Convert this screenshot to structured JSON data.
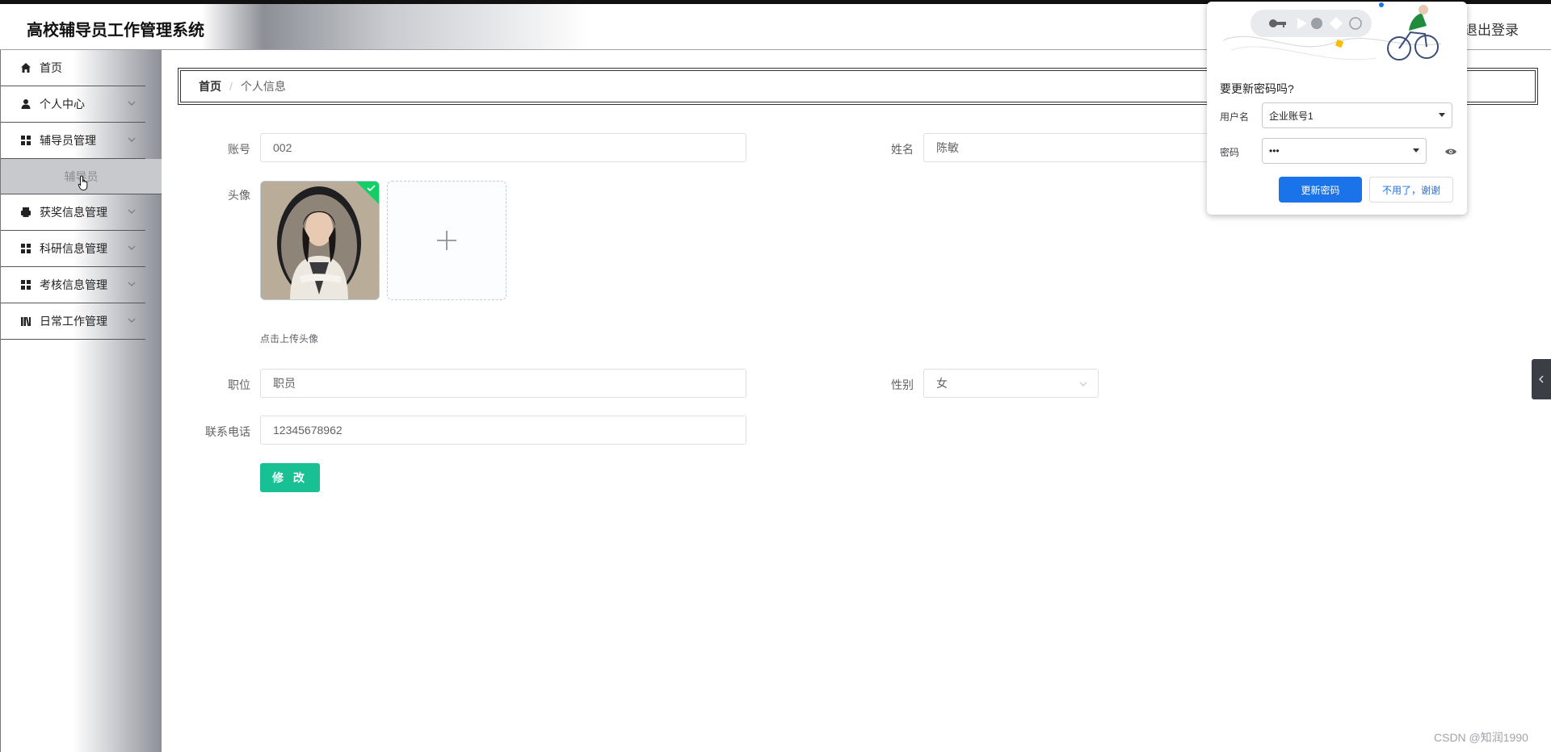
{
  "header": {
    "app_title": "高校辅导员工作管理系统",
    "logout_label": "退出登录"
  },
  "sidebar": {
    "items": [
      {
        "label": "首页",
        "icon": "home-icon"
      },
      {
        "label": "个人中心",
        "icon": "user-icon"
      },
      {
        "label": "辅导员管理",
        "icon": "grid-icon"
      },
      {
        "label": "获奖信息管理",
        "icon": "printer-icon"
      },
      {
        "label": "科研信息管理",
        "icon": "grid-icon"
      },
      {
        "label": "考核信息管理",
        "icon": "grid-icon"
      },
      {
        "label": "日常工作管理",
        "icon": "library-icon"
      }
    ],
    "submenu_item": "辅导员"
  },
  "breadcrumb": {
    "home": "首页",
    "separator": "/",
    "current": "个人信息"
  },
  "form": {
    "account_label": "账号",
    "account_value": "002",
    "name_label": "姓名",
    "name_value": "陈敏",
    "avatar_label": "头像",
    "avatar_hint": "点击上传头像",
    "position_label": "职位",
    "position_value": "职员",
    "gender_label": "性别",
    "gender_value": "女",
    "phone_label": "联系电话",
    "phone_value": "12345678962",
    "submit_label": "修 改"
  },
  "password_popup": {
    "title": "要更新密码吗?",
    "username_label": "用户名",
    "username_value": "企业账号1",
    "password_label": "密码",
    "password_value": "•••",
    "update_button": "更新密码",
    "decline_button": "不用了，谢谢"
  },
  "watermark": "CSDN @知润1990",
  "colors": {
    "accent": "#19c093",
    "popup_primary": "#1a73e8",
    "sidebar_selected_bg": "#c7c9cd"
  }
}
